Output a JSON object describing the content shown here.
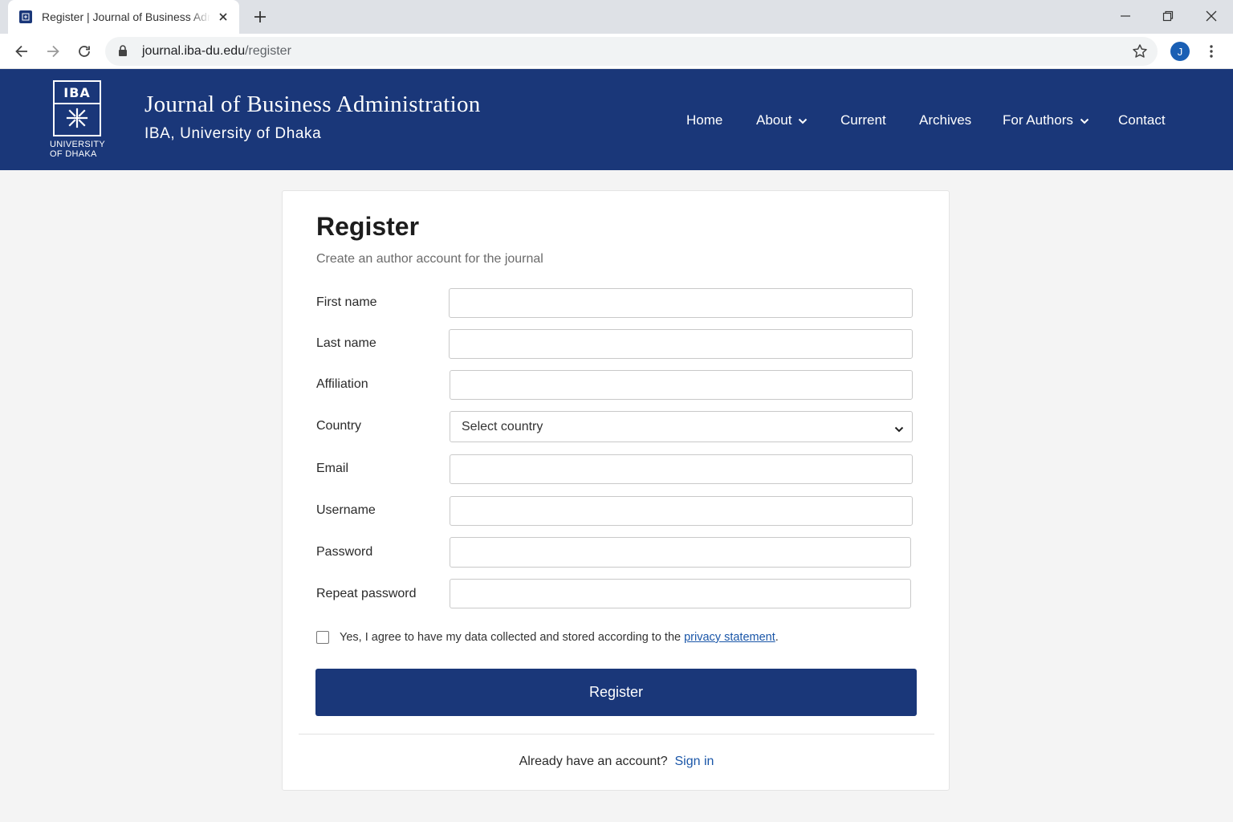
{
  "browser": {
    "tab_title": "Register | Journal of Business Administration",
    "url_host": "journal.iba-du.edu",
    "url_path": "/register",
    "profile_initial": "J"
  },
  "header": {
    "logo_text": "IBA",
    "logo_sub": "UNIVERSITY\nOF DHAKA",
    "title": "Journal of Business Administration",
    "subtitle": "IBA, University of Dhaka",
    "nav": {
      "home": "Home",
      "about": "About",
      "current": "Current",
      "archives": "Archives",
      "for_authors": "For Authors",
      "contact": "Contact"
    }
  },
  "form": {
    "title": "Register",
    "subtitle": "Create an author account for the journal",
    "fields": {
      "first_name": "First name",
      "last_name": "Last name",
      "affiliation": "Affiliation",
      "country": "Country",
      "email": "Email",
      "username": "Username",
      "password": "Password",
      "repeat_password": "Repeat password"
    },
    "country_selected": "Select country",
    "consent_text": "Yes, I agree to have my data collected and stored according to the ",
    "consent_link": "privacy statement",
    "consent_end": ".",
    "submit_label": "Register",
    "signin_prompt": "Already have an account? ",
    "signin_link": "Sign in"
  },
  "colors": {
    "brand": "#1a3779",
    "link": "#1a56a8"
  }
}
